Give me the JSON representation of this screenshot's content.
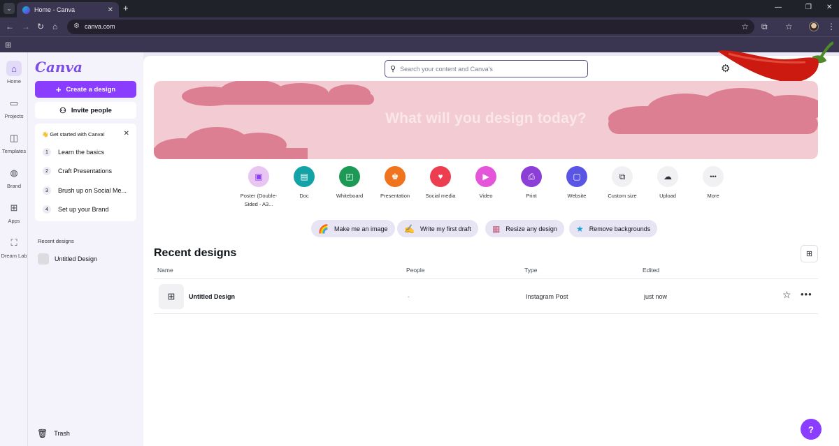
{
  "browser": {
    "tab_title": "Home - Canva",
    "url": "canva.com",
    "tab_list_glyph": "⌄",
    "tab_close_glyph": "✕",
    "new_tab_glyph": "+"
  },
  "rail": {
    "items": [
      {
        "label": "Home",
        "icon": "home-icon",
        "glyph": "⌂",
        "active": true
      },
      {
        "label": "Projects",
        "icon": "folder-icon",
        "glyph": "▭"
      },
      {
        "label": "Templates",
        "icon": "templates-icon",
        "glyph": "◫"
      },
      {
        "label": "Brand",
        "icon": "brand-icon",
        "glyph": "◍"
      },
      {
        "label": "Apps",
        "icon": "apps-icon",
        "glyph": "⊞"
      },
      {
        "label": "Dream Lab",
        "icon": "dream-lab-icon",
        "glyph": "⛶"
      }
    ]
  },
  "panel": {
    "logo": "Canva",
    "create_label": "Create a design",
    "invite_label": "Invite people",
    "getting_started": {
      "title": "👋 Get started with Canva!",
      "items": [
        {
          "num": "1",
          "label": "Learn the basics"
        },
        {
          "num": "2",
          "label": "Craft Presentations"
        },
        {
          "num": "3",
          "label": "Brush up on Social Me..."
        },
        {
          "num": "4",
          "label": "Set up your Brand"
        }
      ]
    },
    "recent_label": "Recent designs",
    "recent_item": "Untitled Design",
    "trash_label": "Trash"
  },
  "main": {
    "search_placeholder": "Search your content and Canva's",
    "hero_title": "What will you design today?",
    "design_types": [
      {
        "label": "Poster (Double-Sided - A3...",
        "color": "#e9c5f2",
        "glyph": "▣",
        "icon": "poster-icon"
      },
      {
        "label": "Doc",
        "color": "#13a3a6",
        "glyph": "▤",
        "icon": "doc-icon"
      },
      {
        "label": "Whiteboard",
        "color": "#1c9a55",
        "glyph": "◰",
        "icon": "whiteboard-icon"
      },
      {
        "label": "Presentation",
        "color": "#f0731d",
        "glyph": "♚",
        "icon": "presentation-icon"
      },
      {
        "label": "Social media",
        "color": "#ec3e50",
        "glyph": "♥",
        "icon": "social-media-icon"
      },
      {
        "label": "Video",
        "color": "#e455d9",
        "glyph": "▶",
        "icon": "video-icon"
      },
      {
        "label": "Print",
        "color": "#8b3fd6",
        "glyph": "⎙",
        "icon": "print-icon"
      },
      {
        "label": "Website",
        "color": "#5b55e6",
        "glyph": "▢",
        "icon": "website-icon"
      },
      {
        "label": "Custom size",
        "color": "#f1f1f4",
        "glyph": "⧉",
        "icon": "custom-size-icon"
      },
      {
        "label": "Upload",
        "color": "#f1f1f4",
        "glyph": "☁",
        "icon": "upload-icon"
      },
      {
        "label": "More",
        "color": "#f1f1f4",
        "glyph": "•••",
        "icon": "more-icon"
      }
    ],
    "chips": [
      {
        "label": "Make me an image",
        "glyph": "🌈",
        "icon": "rainbow-icon"
      },
      {
        "label": "Write my first draft",
        "glyph": "✍",
        "icon": "pen-icon"
      },
      {
        "label": "Resize any design",
        "glyph": "▦",
        "icon": "resize-icon"
      },
      {
        "label": "Remove backgrounds",
        "glyph": "★",
        "icon": "star-cut-icon"
      }
    ],
    "recent_title": "Recent designs",
    "columns": [
      "Name",
      "People",
      "Type",
      "Edited"
    ],
    "rows": [
      {
        "name": "Untitled Design",
        "people": "-",
        "type": "Instagram Post",
        "edited": "just now"
      }
    ],
    "help_label": "?"
  }
}
